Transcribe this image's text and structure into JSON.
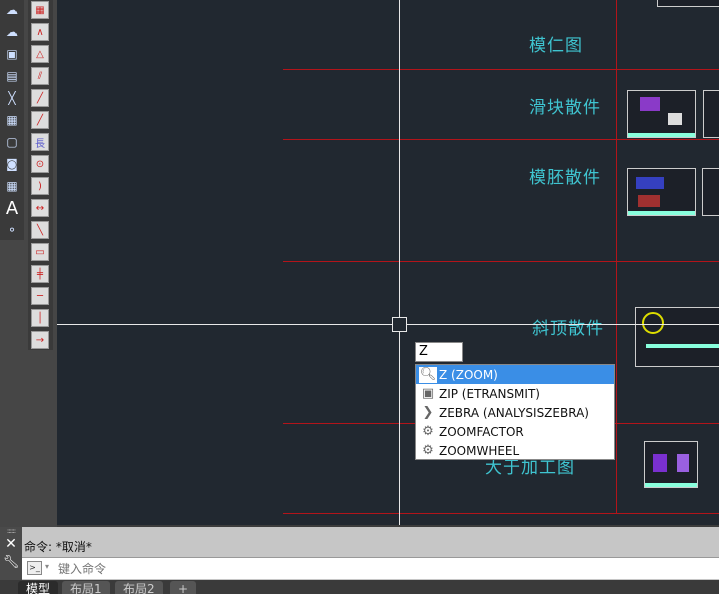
{
  "toolbar_left": {
    "icons": [
      "cloud-icon",
      "revcloud-icon",
      "block-icon",
      "wblock-icon",
      "xline-icon",
      "hatch-icon",
      "region-icon",
      "wipeout-icon",
      "table-icon",
      "text-icon",
      "point-icon"
    ]
  },
  "toolbar_right": {
    "icons": [
      "color-icon",
      "polyline-icon",
      "triangle-icon",
      "hatch-lines-icon",
      "dash-line-icon",
      "line-icon",
      "length-icon",
      "circle-dim-icon",
      "arc-icon",
      "dim-icon",
      "point-line-icon",
      "rect-icon",
      "break-icon",
      "split-icon",
      "vertical-dim-icon",
      "arrow-dim-icon"
    ],
    "length_glyph": "長",
    "text_glyph": "A"
  },
  "drawing": {
    "labels": [
      "模仁图",
      "滑块散件",
      "模胚散件",
      "斜顶散件",
      "大于加工图"
    ],
    "colors": {
      "background": "#212830",
      "grid_lines": "#b3141a",
      "label": "#3fc4d0"
    }
  },
  "command_input": {
    "value": "Z"
  },
  "autocomplete": {
    "items": [
      {
        "label": "Z (ZOOM)",
        "icon": "zoom-icon",
        "selected": true
      },
      {
        "label": "ZIP (ETRANSMIT)",
        "icon": "etransmit-icon",
        "selected": false
      },
      {
        "label": "ZEBRA (ANALYSISZEBRA)",
        "icon": "zebra-icon",
        "selected": false
      },
      {
        "label": "ZOOMFACTOR",
        "icon": "gear-icon",
        "selected": false
      },
      {
        "label": "ZOOMWHEEL",
        "icon": "gear-icon",
        "selected": false
      }
    ]
  },
  "command_window": {
    "history": "命令:  *取消*",
    "placeholder": "键入命令"
  },
  "layout_tabs": [
    {
      "label": "模型",
      "active": true
    },
    {
      "label": "布局1",
      "active": false
    },
    {
      "label": "布局2",
      "active": false
    },
    {
      "label": "+",
      "active": false
    }
  ]
}
